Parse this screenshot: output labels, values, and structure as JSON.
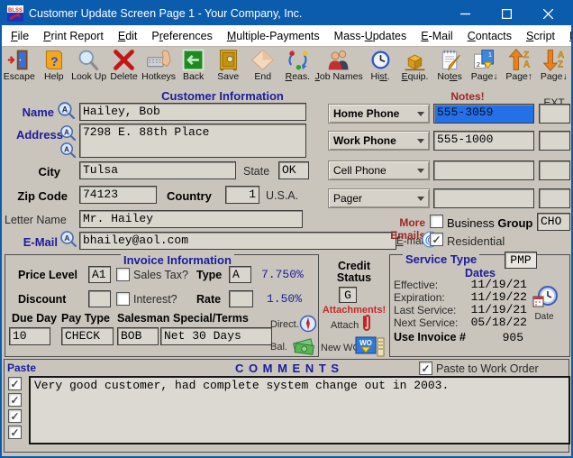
{
  "window": {
    "title": "Customer Update Screen Page 1 - Your Company, Inc.",
    "app_icon": "blss-logo-icon",
    "controls": [
      "minimize-icon",
      "maximize-icon",
      "close-icon"
    ]
  },
  "menu": {
    "items": [
      {
        "label": "File",
        "u": "F"
      },
      {
        "label": "Print Report",
        "u": "P"
      },
      {
        "label": "Edit",
        "u": "E"
      },
      {
        "label": "Preferences",
        "u": "r"
      },
      {
        "label": "Multiple-Payments",
        "u": "M"
      },
      {
        "label": "Mass-Updates",
        "u": "U"
      },
      {
        "label": "E-Mail",
        "u": "E"
      },
      {
        "label": "Contacts",
        "u": "C"
      },
      {
        "label": "Script",
        "u": "S"
      },
      {
        "label": "Help",
        "u": "H"
      }
    ]
  },
  "toolbar": {
    "items": [
      {
        "label": "Escape",
        "icon": "escape-door-icon"
      },
      {
        "label": "Help",
        "icon": "help-book-icon"
      },
      {
        "label": "Look Up",
        "icon": "lookup-magnifier-icon"
      },
      {
        "label": "Delete",
        "icon": "delete-x-icon"
      },
      {
        "label": "Hotkeys",
        "icon": "hotkeys-keyboard-icon"
      },
      {
        "label": "Back",
        "icon": "back-arrow-icon"
      },
      {
        "label": "Save",
        "icon": "save-safe-icon"
      },
      {
        "label": "End",
        "icon": "end-diamond-icon"
      },
      {
        "label": "Reas.",
        "u": "R",
        "icon": "reassign-arrows-icon"
      },
      {
        "label": "Job Names",
        "u": "J",
        "icon": "job-names-people-icon"
      },
      {
        "label": "Hist.",
        "u": "st",
        "icon": "history-clock-icon"
      },
      {
        "label": "Equip.",
        "u": "E",
        "icon": "equipment-boxes-icon"
      },
      {
        "label": "Notes",
        "u": "te",
        "icon": "notes-notepad-icon"
      },
      {
        "label": "Page↓",
        "icon": "page-down-icon"
      },
      {
        "label": "Page↑",
        "icon": "page-up-sort-za-icon"
      },
      {
        "label": "Page↓",
        "icon": "page-down-sort-az-icon"
      }
    ]
  },
  "customer": {
    "section_title": "Customer Information",
    "name": {
      "label": "Name",
      "value": "Hailey, Bob"
    },
    "address": {
      "label": "Address",
      "value": "7298 E. 88th Place"
    },
    "city": {
      "label": "City",
      "value": "Tulsa"
    },
    "state": {
      "label": "State",
      "value": "OK"
    },
    "zip": {
      "label": "Zip Code",
      "value": "74123"
    },
    "country": {
      "label": "Country",
      "value": "1",
      "suffix": "U.S.A."
    },
    "letter_name": {
      "label": "Letter Name",
      "value": "Mr. Hailey"
    },
    "email": {
      "label": "E-Mail",
      "value": "bhailey@aol.com"
    },
    "notes_link": "Notes!",
    "ext_header": "EXT.",
    "phones": [
      {
        "type": "Home Phone",
        "value": "555-3059",
        "ext": "",
        "bold": true,
        "selected": true
      },
      {
        "type": "Work Phone",
        "value": "555-1000",
        "ext": "",
        "bold": true,
        "selected": false
      },
      {
        "type": "Cell Phone",
        "value": "",
        "ext": "",
        "bold": false,
        "selected": false
      },
      {
        "type": "Pager",
        "value": "",
        "ext": "",
        "bold": false,
        "selected": false
      }
    ],
    "more_emails_link": "More Emails",
    "emails_label": "E-mails",
    "emails_label_u": "E",
    "business": {
      "label": "Business",
      "group_label": "Group",
      "checked": false,
      "value": "CHO"
    },
    "residential": {
      "label": "Residential",
      "checked": true
    }
  },
  "invoice": {
    "section_title": "Invoice Information",
    "price_level": {
      "label": "Price Level",
      "value": "A1"
    },
    "sales_tax": {
      "label": "Sales Tax?",
      "checked": false
    },
    "type": {
      "label": "Type",
      "value": "A"
    },
    "tax_rate": "7.750%",
    "discount": {
      "label": "Discount",
      "value": ""
    },
    "interest": {
      "label": "Interest?",
      "checked": false
    },
    "rate": {
      "label": "Rate",
      "value": ""
    },
    "interest_rate": "1.50%",
    "due_day": {
      "label": "Due Day",
      "value": "10"
    },
    "pay_type": {
      "label": "Pay Type",
      "value": "CHECK"
    },
    "salesman": {
      "label": "Salesman",
      "value": "BOB"
    },
    "special_terms": {
      "label": "Special/Terms",
      "value": "Net 30 Days"
    },
    "direct_label": "Direct.",
    "bal_label": "Bal."
  },
  "credit": {
    "label_line1": "Credit",
    "label_line2": "Status",
    "value": "G",
    "attachments_link": "Attachments!",
    "attach_label": "Attach",
    "new_wo_label": "New WO"
  },
  "service": {
    "section_title": "Service Type",
    "type_value": "PMP",
    "dates_header": "Dates",
    "rows": [
      {
        "label": "Effective:",
        "value": "11/19/21"
      },
      {
        "label": "Expiration:",
        "value": "11/19/22"
      },
      {
        "label": "Last Service:",
        "value": "11/19/21"
      },
      {
        "label": "Next Service:",
        "value": "05/18/22"
      }
    ],
    "use_invoice": {
      "label": "Use Invoice #",
      "value": "905"
    },
    "date_icon_label": "Date"
  },
  "comments": {
    "paste_label": "Paste",
    "header": "C O M M E N T S",
    "paste_to_wo": {
      "label": "Paste to Work Order",
      "checked": true
    },
    "row_checkboxes": [
      true,
      true,
      true,
      true
    ],
    "text": "Very good customer, had complete system change out in 2003."
  },
  "colors": {
    "titlebar": "#0b5cad",
    "label_navy": "#1c1c9c",
    "link_red": "#a32525",
    "attachments_red": "#c32b2b",
    "selection_blue": "#2470e8",
    "form_gray": "#c9c5bc"
  }
}
